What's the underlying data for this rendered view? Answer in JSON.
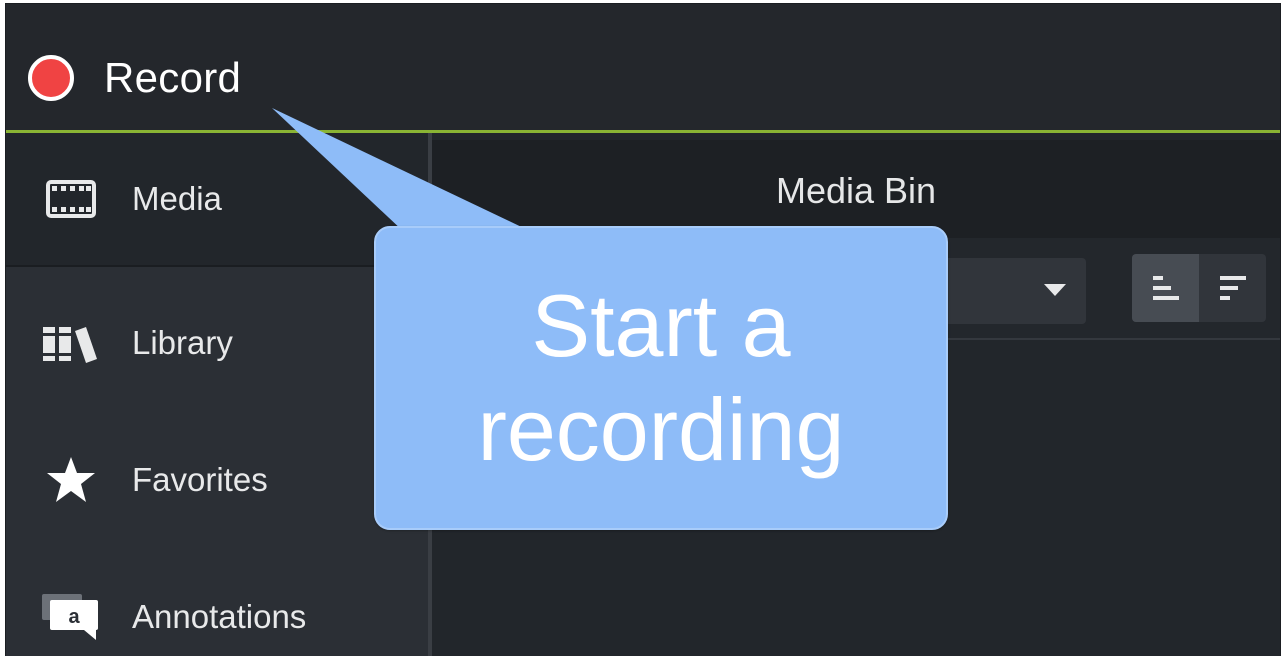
{
  "topbar": {
    "record_label": "Record",
    "accent_color": "#8ab434",
    "record_color": "#f04343"
  },
  "sidebar": {
    "items": [
      {
        "label": "Media",
        "icon": "film-strip-icon",
        "active": true
      },
      {
        "label": "Library",
        "icon": "library-books-icon",
        "active": false
      },
      {
        "label": "Favorites",
        "icon": "star-icon",
        "active": false
      },
      {
        "label": "Annotations",
        "icon": "annotation-speech-bubble-icon",
        "active": false
      }
    ]
  },
  "media_bin": {
    "title": "Media Bin",
    "dropdown_icon": "chevron-down-icon",
    "view_buttons": [
      {
        "icon": "list-view-icon",
        "selected": true
      },
      {
        "icon": "sort-icon",
        "selected": false
      }
    ]
  },
  "callout": {
    "text": "Start a\nrecording",
    "color": "#8ebcf8"
  }
}
